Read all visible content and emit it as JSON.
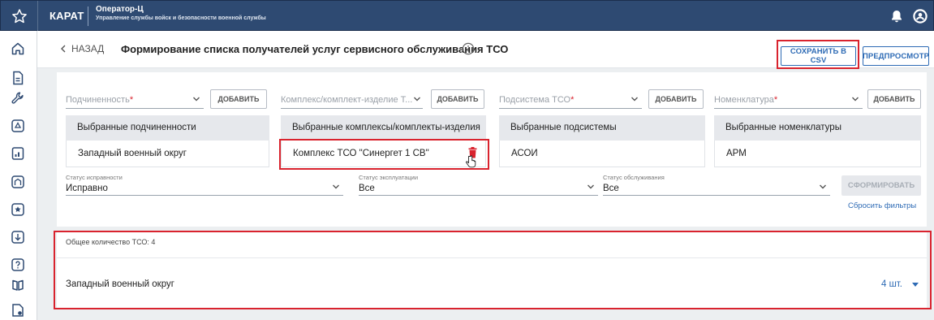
{
  "topbar": {
    "brand": "КАРАТ",
    "app_title": "Оператор-Ц",
    "app_subtitle": "Управление службы войск и безопасности военной службы",
    "bg_color": "#2e4a72"
  },
  "sidebar": {
    "items": [
      "home-icon",
      "document-icon",
      "wrench-icon",
      "map-pin-icon",
      "report-icon",
      "building-icon",
      "shield-star-icon",
      "download-icon",
      "help-icon",
      "book-icon",
      "file-settings-icon"
    ]
  },
  "header": {
    "back_label": "НАЗАД",
    "title": "Формирование списка получателей услуг сервисного обслуживания ТСО",
    "save_csv_label": "СОХРАНИТЬ В CSV",
    "preview_label": "ПРЕДПРОСМОТР"
  },
  "filters": {
    "add_label": "ДОБАВИТЬ",
    "fields": [
      {
        "label": "Подчиненность",
        "required": "*"
      },
      {
        "label": "Комплекс/комплект-изделие Т...",
        "required": ""
      },
      {
        "label": "Подсистема ТСО",
        "required": "*"
      },
      {
        "label": "Номенклатура",
        "required": "*"
      }
    ],
    "selected": [
      {
        "header": "Выбранные подчиненности",
        "value": "Западный военный округ"
      },
      {
        "header": "Выбранные комплексы/комплекты-изделия",
        "value": "Комплекс ТСО \"Синергет 1 СВ\""
      },
      {
        "header": "Выбранные подсистемы",
        "value": "АСОИ"
      },
      {
        "header": "Выбранные номенклатуры",
        "value": "АРМ"
      }
    ],
    "statuses": [
      {
        "caption": "Статус исправности",
        "value": "Исправно"
      },
      {
        "caption": "Статус эксплуатации",
        "value": "Все"
      },
      {
        "caption": "Статус обслуживания",
        "value": "Все"
      }
    ],
    "form_button_label": "СФОРМИРОВАТЬ",
    "reset_label": "Сбросить фильтры"
  },
  "results": {
    "total_label": "Общее количество ТСО: 4",
    "rows": [
      {
        "label": "Западный военный округ",
        "count": "4 шт."
      }
    ]
  },
  "colors": {
    "accent": "#2e6bb5",
    "highlight": "#d9232e",
    "delete": "#d9232e"
  }
}
